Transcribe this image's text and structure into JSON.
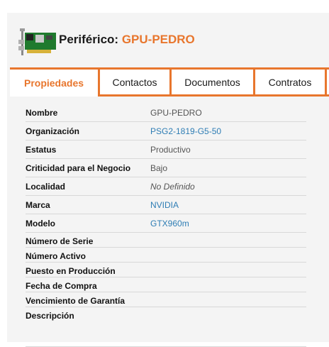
{
  "header": {
    "title_prefix": "Periférico: ",
    "device_name": "GPU-PEDRO",
    "icon": "pci-card-icon"
  },
  "tabs": [
    {
      "label": "Propiedades",
      "active": true
    },
    {
      "label": "Contactos",
      "active": false
    },
    {
      "label": "Documentos",
      "active": false
    },
    {
      "label": "Contratos",
      "active": false
    }
  ],
  "properties": [
    {
      "label": "Nombre",
      "value": "GPU-PEDRO"
    },
    {
      "label": "Organización",
      "value": "PSG2-1819-G5-50"
    },
    {
      "label": "Estatus",
      "value": "Productivo"
    },
    {
      "label": "Criticidad para el Negocio",
      "value": "Bajo"
    },
    {
      "label": "Localidad",
      "value": "No Definido"
    },
    {
      "label": "Marca",
      "value": "NVIDIA"
    },
    {
      "label": "Modelo",
      "value": "GTX960m"
    },
    {
      "label": "Número de Serie",
      "value": ""
    },
    {
      "label": "Número Activo",
      "value": ""
    },
    {
      "label": "Puesto en Producción",
      "value": ""
    },
    {
      "label": "Fecha de Compra",
      "value": ""
    },
    {
      "label": "Vencimiento de Garantía",
      "value": ""
    },
    {
      "label": "Descripción",
      "value": ""
    }
  ],
  "colors": {
    "accent": "#e8762d",
    "link": "#2e7db4"
  }
}
